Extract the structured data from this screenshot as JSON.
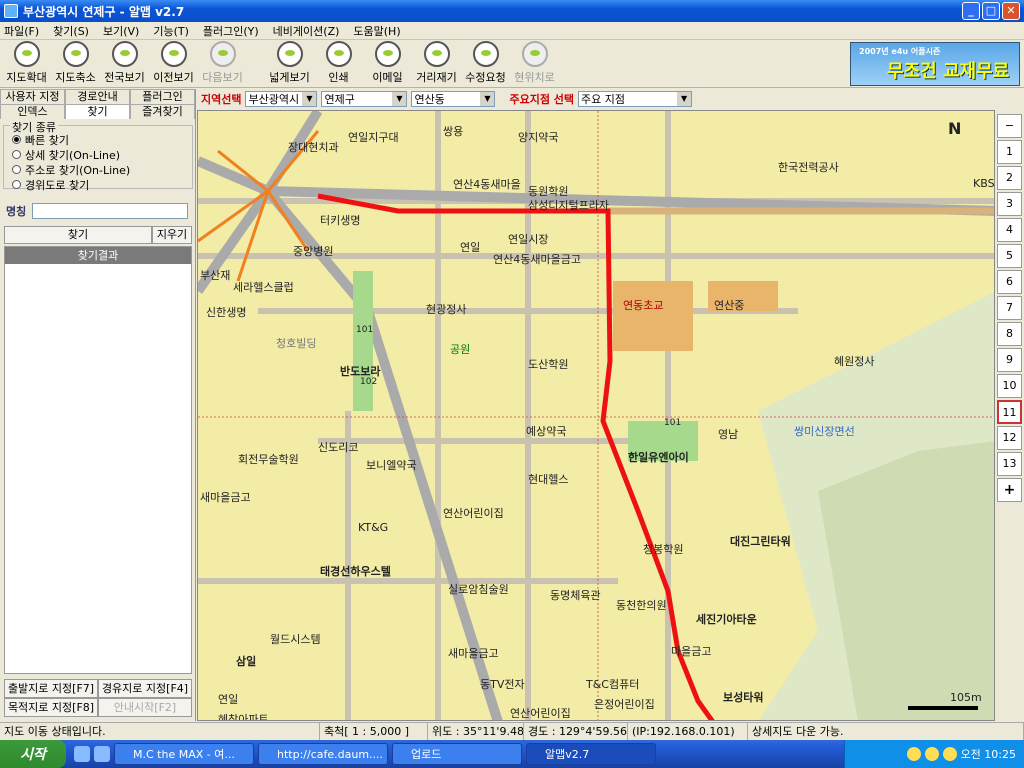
{
  "window": {
    "title": "부산광역시 연제구 - 알맵 v2.7",
    "minimize": "_",
    "maximize": "□",
    "close": "✕"
  },
  "menu": [
    "파일(F)",
    "찾기(S)",
    "보기(V)",
    "기능(T)",
    "플러그인(Y)",
    "네비게이션(Z)",
    "도움말(H)"
  ],
  "toolbar": [
    "지도확대",
    "지도축소",
    "전국보기",
    "이전보기",
    "다음보기",
    "넓게보기",
    "인쇄",
    "이메일",
    "거리재기",
    "수정요청",
    "현위치로"
  ],
  "ad": {
    "small": "2007년 e4u 어플시즌",
    "main": "무조건 교재무료"
  },
  "left": {
    "tabs": [
      "사용자 지정",
      "경로안내",
      "플러그인",
      "인덱스",
      "찾기",
      "즐겨찾기"
    ],
    "group_title": "찾기 종류",
    "options": [
      "빠른 찾기",
      "상세 찾기(On-Line)",
      "주소로 찾기(On-Line)",
      "경위도로 찾기"
    ],
    "name_label": "명칭",
    "find": "찾기",
    "clear": "지우기",
    "results": "찾기결과",
    "buttons": [
      "출발지로 지정[F7]",
      "경유지로 지정[F4]",
      "목적지로 지정[F8]",
      "안내시작[F2]"
    ]
  },
  "filter": {
    "region_label": "지역선택",
    "sido": "부산광역시",
    "gu": "연제구",
    "dong": "연산동",
    "poi_label": "주요지점 선택",
    "poi": "주요 지점"
  },
  "map": {
    "compass": "N",
    "scale": "105m",
    "labels": [
      {
        "t": "연일지구대"
      },
      {
        "t": "쌍용"
      },
      {
        "t": "양지약국"
      },
      {
        "t": "장대현치과"
      },
      {
        "t": "한국전력공사"
      },
      {
        "t": "연산4동새마을"
      },
      {
        "t": "동원학원"
      },
      {
        "t": "삼성디지털프라자"
      },
      {
        "t": "KBS"
      },
      {
        "t": "터키생명"
      },
      {
        "t": "연일"
      },
      {
        "t": "연일시장"
      },
      {
        "t": "연산4동새마을금고"
      },
      {
        "t": "중앙병원"
      },
      {
        "t": "부산재"
      },
      {
        "t": "세라헬스클럽"
      },
      {
        "t": "신한생명"
      },
      {
        "t": "현광정사"
      },
      {
        "t": "연동초교"
      },
      {
        "t": "연산중"
      },
      {
        "t": "청호빌딩"
      },
      {
        "t": "공원"
      },
      {
        "t": "도산학원"
      },
      {
        "t": "혜원정사"
      },
      {
        "t": "반도보라"
      },
      {
        "t": "예상약국"
      },
      {
        "t": "영남"
      },
      {
        "t": "쌍미신장면선"
      },
      {
        "t": "한일유엔아이"
      },
      {
        "t": "신도리코"
      },
      {
        "t": "회전무술학원"
      },
      {
        "t": "보니엘약국"
      },
      {
        "t": "현대헬스"
      },
      {
        "t": "새마을금고"
      },
      {
        "t": "연산어린이집"
      },
      {
        "t": "KT&G"
      },
      {
        "t": "청봉학원"
      },
      {
        "t": "대진그린타워"
      },
      {
        "t": "태경선하우스텔"
      },
      {
        "t": "실로암침술원"
      },
      {
        "t": "동명체육관"
      },
      {
        "t": "동천한의원"
      },
      {
        "t": "세진기아타운"
      },
      {
        "t": "월드시스템"
      },
      {
        "t": "새마을금고"
      },
      {
        "t": "삼일"
      },
      {
        "t": "마을금고"
      },
      {
        "t": "동TV전자"
      },
      {
        "t": "T&C컴퓨터"
      },
      {
        "t": "연일"
      },
      {
        "t": "은정어린이집"
      },
      {
        "t": "연산어린이집"
      },
      {
        "t": "보성타워"
      },
      {
        "t": "혜창아파트"
      },
      {
        "t": "101"
      },
      {
        "t": "102"
      },
      {
        "t": "101"
      }
    ],
    "route_color": "#ee1111"
  },
  "zoom": [
    "−",
    "1",
    "2",
    "3",
    "4",
    "5",
    "6",
    "7",
    "8",
    "9",
    "10",
    "11",
    "12",
    "13",
    "+"
  ],
  "status": [
    "지도 이동 상태입니다.",
    "축척[ 1 : 5,000 ]",
    "위도 : 35°11'9.48\"",
    "경도 : 129°4'59.56\"",
    "(IP:192.168.0.101)",
    "상세지도 다운 가능."
  ],
  "taskbar": {
    "start": "시작",
    "tasks": [
      "M.C the MAX - 여...",
      "http://cafe.daum....",
      "업로드",
      "알맵v2.7"
    ],
    "clock": "오전 10:25"
  }
}
